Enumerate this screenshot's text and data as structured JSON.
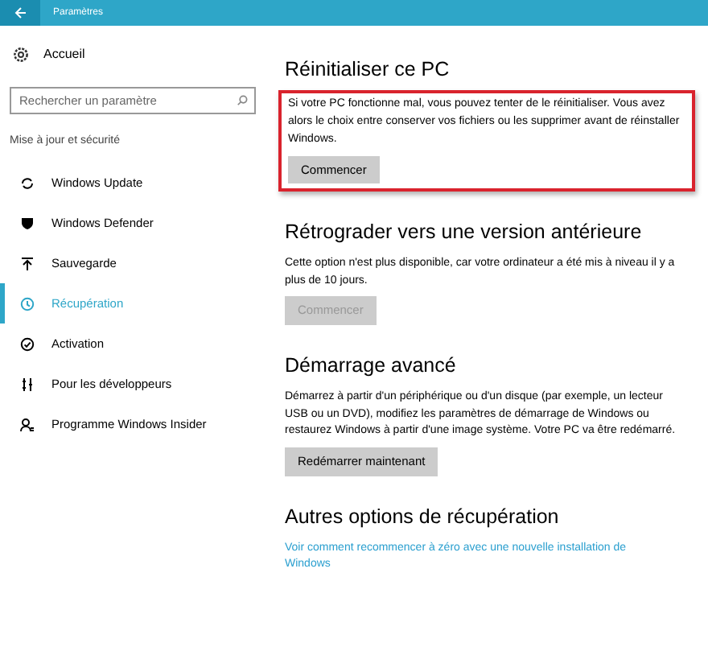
{
  "window": {
    "title": "Paramètres"
  },
  "sidebar": {
    "home": "Accueil",
    "search": {
      "placeholder": "Rechercher un paramètre"
    },
    "section_label": "Mise à jour et sécurité",
    "items": [
      {
        "label": "Windows Update",
        "selected": false
      },
      {
        "label": "Windows Defender",
        "selected": false
      },
      {
        "label": "Sauvegarde",
        "selected": false
      },
      {
        "label": "Récupération",
        "selected": true
      },
      {
        "label": "Activation",
        "selected": false
      },
      {
        "label": "Pour les développeurs",
        "selected": false
      },
      {
        "label": "Programme Windows Insider",
        "selected": false
      }
    ]
  },
  "sections": [
    {
      "title": "Réinitialiser ce PC",
      "highlighted": true,
      "text": "Si votre PC fonctionne mal, vous pouvez tenter de le réinitialiser. Vous avez alors le choix entre conserver vos fichiers ou les supprimer avant de réinstaller Windows.",
      "button": {
        "label": "Commencer",
        "disabled": false
      }
    },
    {
      "title": "Rétrograder vers une version antérieure",
      "highlighted": false,
      "text": "Cette option n'est plus disponible, car votre ordinateur a été mis à niveau il y a plus de 10 jours.",
      "button": {
        "label": "Commencer",
        "disabled": true
      }
    },
    {
      "title": "Démarrage avancé",
      "highlighted": false,
      "text": "Démarrez à partir d'un périphérique ou d'un disque (par exemple, un lecteur USB ou un DVD), modifiez les paramètres de démarrage de Windows ou restaurez Windows à partir d'une image système. Votre PC va être redémarré.",
      "button": {
        "label": "Redémarrer maintenant",
        "disabled": false
      }
    },
    {
      "title": "Autres options de récupération",
      "highlighted": false,
      "link": "Voir comment recommencer à zéro avec une nouvelle installation de Windows"
    }
  ]
}
